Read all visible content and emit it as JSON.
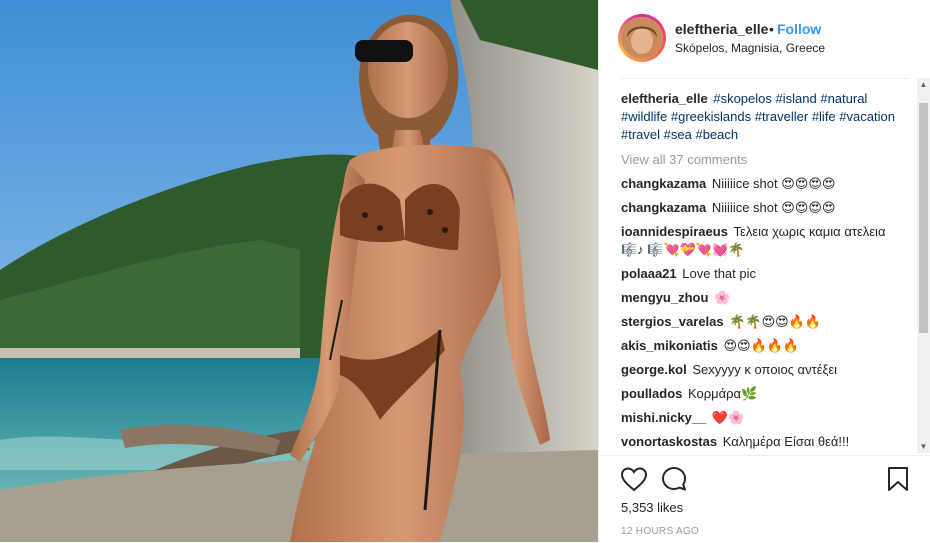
{
  "post": {
    "username": "eleftheria_elle",
    "separator": "•",
    "follow_label": "Follow",
    "location": "Skópelos, Magnisia, Greece"
  },
  "caption": {
    "username": "eleftheria_elle",
    "hashtags": [
      "#skopelos",
      "#island",
      "#natural",
      "#wildlife",
      "#greekislands",
      "#traveller",
      "#life",
      "#vacation",
      "#travel",
      "#sea",
      "#beach"
    ]
  },
  "view_all_comments": "View all 37 comments",
  "comments": [
    {
      "user": "changkazama",
      "text": "Niiiiice shot 😍😍😍😍"
    },
    {
      "user": "changkazama",
      "text": "Niiiiice shot 😍😍😍😍"
    },
    {
      "user": "ioannidespiraeus",
      "text": "Τελεια χωρις καμια ατελεια 🎼♪ 🎼💘💝💘💓🌴"
    },
    {
      "user": "polaaa21",
      "text": "Love that pic"
    },
    {
      "user": "mengyu_zhou",
      "text": "🌸"
    },
    {
      "user": "stergios_varelas",
      "text": "🌴🌴😍😍🔥🔥"
    },
    {
      "user": "akis_mikoniatis",
      "text": "😍😍🔥🔥🔥"
    },
    {
      "user": "george.kol",
      "text": "Sexyyyy κ οποιος αντέξει"
    },
    {
      "user": "poullados",
      "text": "Κορμάρα🌿"
    },
    {
      "user": "mishi.nicky__",
      "text": "❤️🌸"
    },
    {
      "user": "vonortaskostas",
      "text": "Καλημέρα Είσαι θεά!!!"
    }
  ],
  "likes_text": "5,353 likes",
  "time_text": "12 HOURS AGO",
  "icons": {
    "like": "heart-icon",
    "comment": "comment-icon",
    "save": "bookmark-icon"
  },
  "colors": {
    "follow": "#3897f0",
    "hashtag": "#003569",
    "muted": "#999999",
    "text": "#262626"
  }
}
